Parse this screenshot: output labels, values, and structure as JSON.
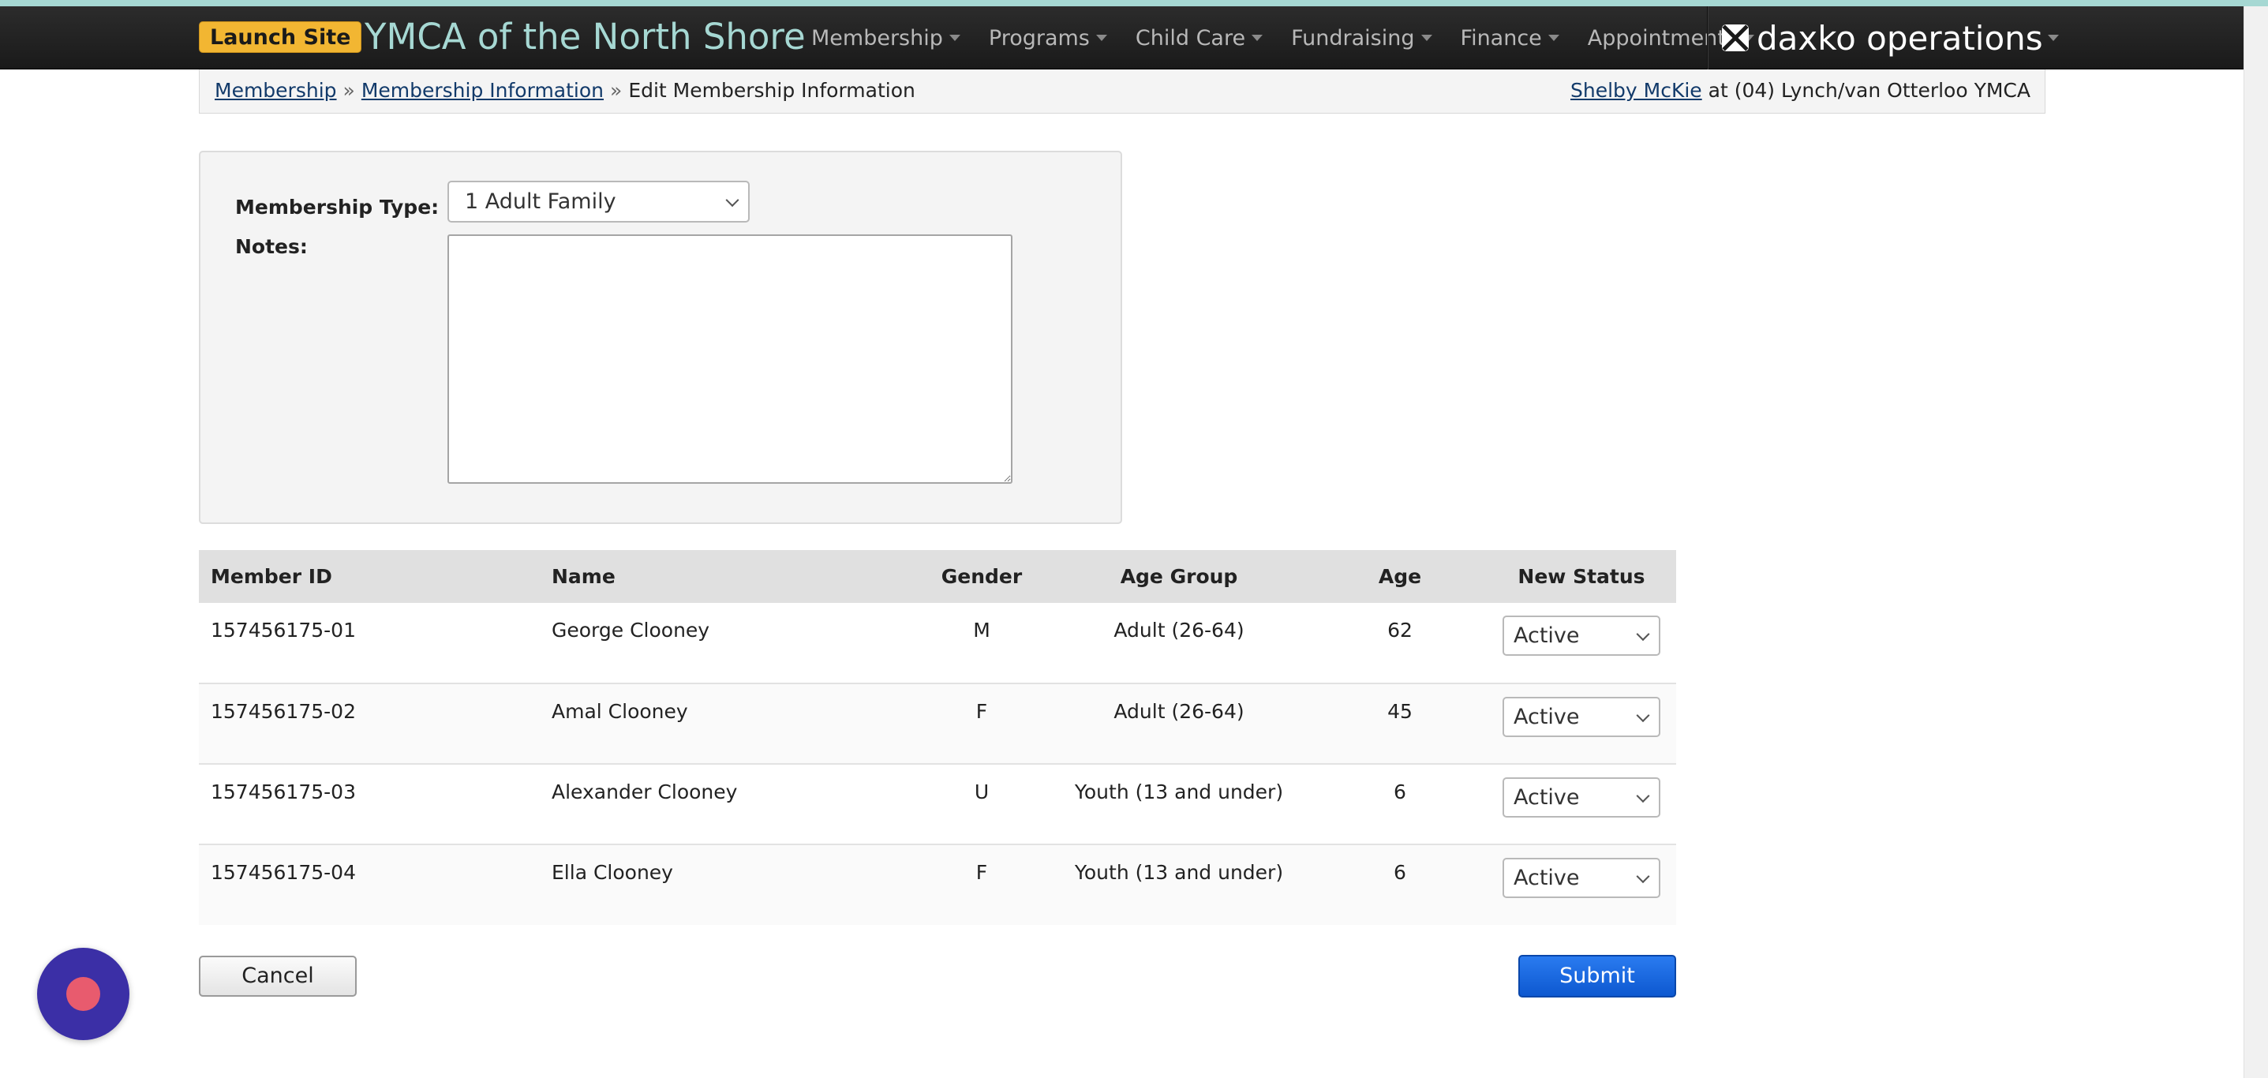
{
  "header": {
    "launch_label": "Launch Site",
    "site_title": "YMCA of the North Shore",
    "nav": [
      "Membership",
      "Programs",
      "Child Care",
      "Fundraising",
      "Finance",
      "Appointments"
    ],
    "brand": "daxko operations",
    "accent_color": "#a6d8d3"
  },
  "breadcrumb": {
    "items": [
      "Membership",
      "Membership Information"
    ],
    "current": "Edit Membership Information"
  },
  "user": {
    "name": "Shelby McKie",
    "location": "at (04) Lynch/van Otterloo YMCA"
  },
  "form": {
    "membership_type_label": "Membership Type:",
    "membership_type_value": "1 Adult Family",
    "notes_label": "Notes:",
    "notes_value": ""
  },
  "table": {
    "headers": [
      "Member ID",
      "Name",
      "Gender",
      "Age Group",
      "Age",
      "New Status"
    ],
    "rows": [
      {
        "id": "157456175-01",
        "name": "George Clooney",
        "gender": "M",
        "age_group": "Adult (26-64)",
        "age": "62",
        "status": "Active"
      },
      {
        "id": "157456175-02",
        "name": "Amal Clooney",
        "gender": "F",
        "age_group": "Adult (26-64)",
        "age": "45",
        "status": "Active"
      },
      {
        "id": "157456175-03",
        "name": "Alexander Clooney",
        "gender": "U",
        "age_group": "Youth (13 and under)",
        "age": "6",
        "status": "Active"
      },
      {
        "id": "157456175-04",
        "name": "Ella Clooney",
        "gender": "F",
        "age_group": "Youth (13 and under)",
        "age": "6",
        "status": "Active"
      }
    ]
  },
  "actions": {
    "cancel_label": "Cancel",
    "submit_label": "Submit"
  }
}
